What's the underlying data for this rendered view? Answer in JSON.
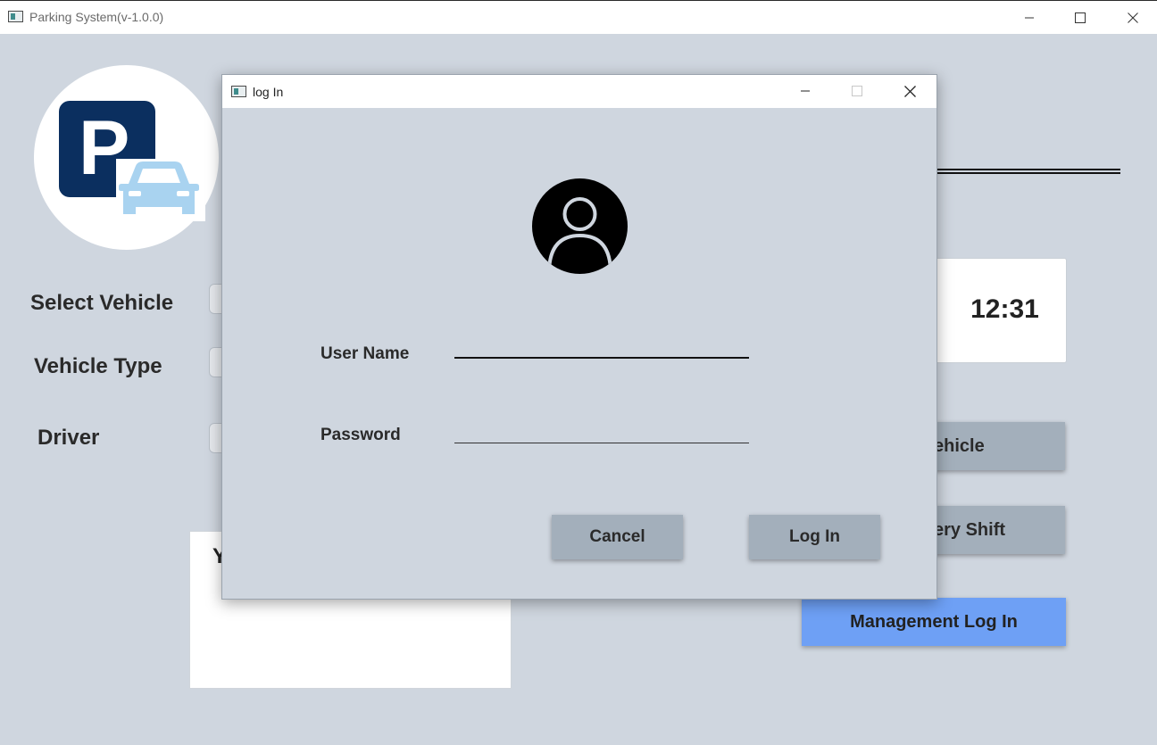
{
  "main_window": {
    "title": "Parking System(v-1.0.0)",
    "controls": {
      "minimize": "minimize-icon",
      "maximize": "maximize-icon",
      "close": "close-icon"
    }
  },
  "logo": {
    "letter": "P",
    "primary_color": "#0b2f5f",
    "car_color": "#a9d3f0"
  },
  "form": {
    "select_vehicle_label": "Select Vehicle",
    "vehicle_type_label": "Vehicle Type",
    "driver_label": "Driver"
  },
  "clock": {
    "time": "12:31"
  },
  "side_buttons": {
    "vehicle_partial": "ehicle",
    "shift_partial": "ery Shift",
    "management_login": "Management Log In"
  },
  "info_box": {
    "partial_text": "Y"
  },
  "login_dialog": {
    "title": "log In",
    "username_label": "User Name",
    "username_value": "",
    "password_label": "Password",
    "password_value": "",
    "cancel_label": "Cancel",
    "login_label": "Log In"
  },
  "colors": {
    "background": "#cfd6df",
    "button": "#a3afbb",
    "accent_button": "#6ea0f5"
  }
}
